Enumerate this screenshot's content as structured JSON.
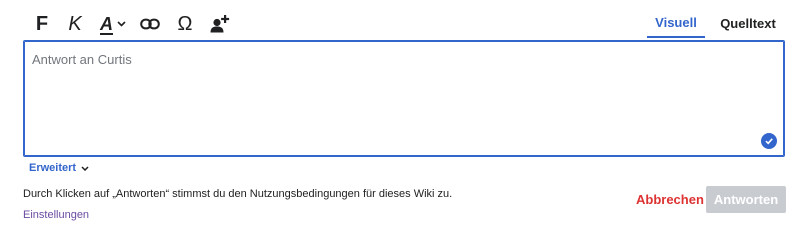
{
  "toolbar": {
    "bold_label": "F",
    "italic_label": "K",
    "style_label": "A",
    "special_char_label": "Ω",
    "icons": [
      "bold-icon",
      "italic-icon",
      "text-style-icon",
      "link-icon",
      "special-character-icon",
      "mention-user-icon"
    ]
  },
  "mode_tabs": {
    "visual": "Visuell",
    "source": "Quelltext",
    "active": "Visuell"
  },
  "editor": {
    "placeholder": "Antwort an Curtis",
    "value": ""
  },
  "advanced_label": "Erweitert",
  "terms_text": "Durch Klicken auf „Antworten“ stimmst du den Nutzungsbedingungen für dieses Wiki zu.",
  "settings_link": "Einstellungen",
  "actions": {
    "cancel": "Abbrechen",
    "submit": "Antworten",
    "submit_disabled": true
  },
  "colors": {
    "accent": "#3366cc",
    "destructive": "#dd3333",
    "disabled": "#c8ccd1",
    "visited_link": "#6b4ba1"
  }
}
